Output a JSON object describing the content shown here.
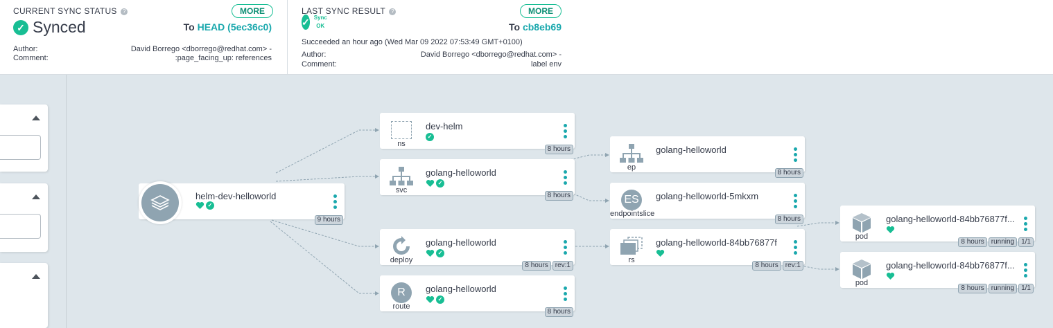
{
  "sync_status": {
    "title": "CURRENT SYNC STATUS",
    "more_label": "MORE",
    "state": "Synced",
    "to_prefix": "To",
    "revision": "HEAD (5ec36c0)",
    "author_label": "Author:",
    "author_value": "David Borrego <dborrego@redhat.com> -",
    "comment_label": "Comment:",
    "comment_value": ":page_facing_up: references"
  },
  "sync_result": {
    "title": "LAST SYNC RESULT",
    "more_label": "MORE",
    "state": "Sync OK",
    "to_prefix": "To",
    "revision": "cb8eb69",
    "succeeded_text": "Succeeded an hour ago (Wed Mar 09 2022 07:53:49 GMT+0100)",
    "author_label": "Author:",
    "author_value": "David Borrego <dborrego@redhat.com> -",
    "comment_label": "Comment:",
    "comment_value": "label env"
  },
  "colors": {
    "accent": "#18be94",
    "link": "#1aa8ad",
    "node_icon": "#8fa4b1",
    "background": "#dee6eb"
  },
  "nodes": {
    "app": {
      "name": "helm-dev-helloworld",
      "tags": [
        "9 hours"
      ],
      "icon": "layers-icon"
    },
    "ns": {
      "name": "dev-helm",
      "kind": "ns",
      "tags": [
        "8 hours"
      ],
      "icon": "namespace-icon"
    },
    "svc": {
      "name": "golang-helloworld",
      "kind": "svc",
      "tags": [
        "8 hours"
      ],
      "icon": "network-icon"
    },
    "deploy": {
      "name": "golang-helloworld",
      "kind": "deploy",
      "tags": [
        "8 hours",
        "rev:1"
      ],
      "icon": "refresh-icon"
    },
    "route": {
      "name": "golang-helloworld",
      "kind": "route",
      "letter": "R",
      "tags": [
        "8 hours"
      ]
    },
    "ep": {
      "name": "golang-helloworld",
      "kind": "ep",
      "tags": [
        "8 hours"
      ],
      "icon": "network-icon"
    },
    "eps": {
      "name": "golang-helloworld-5mkxm",
      "kind": "endpointslice",
      "letter": "ES",
      "tags": [
        "8 hours"
      ]
    },
    "rs": {
      "name": "golang-helloworld-84bb76877f",
      "kind": "rs",
      "tags": [
        "8 hours",
        "rev:1"
      ],
      "icon": "replicaset-icon"
    },
    "pod1": {
      "name": "golang-helloworld-84bb76877f...",
      "kind": "pod",
      "tags": [
        "8 hours",
        "running",
        "1/1"
      ],
      "icon": "cube-icon"
    },
    "pod2": {
      "name": "golang-helloworld-84bb76877f...",
      "kind": "pod",
      "tags": [
        "8 hours",
        "running",
        "1/1"
      ],
      "icon": "cube-icon"
    }
  }
}
